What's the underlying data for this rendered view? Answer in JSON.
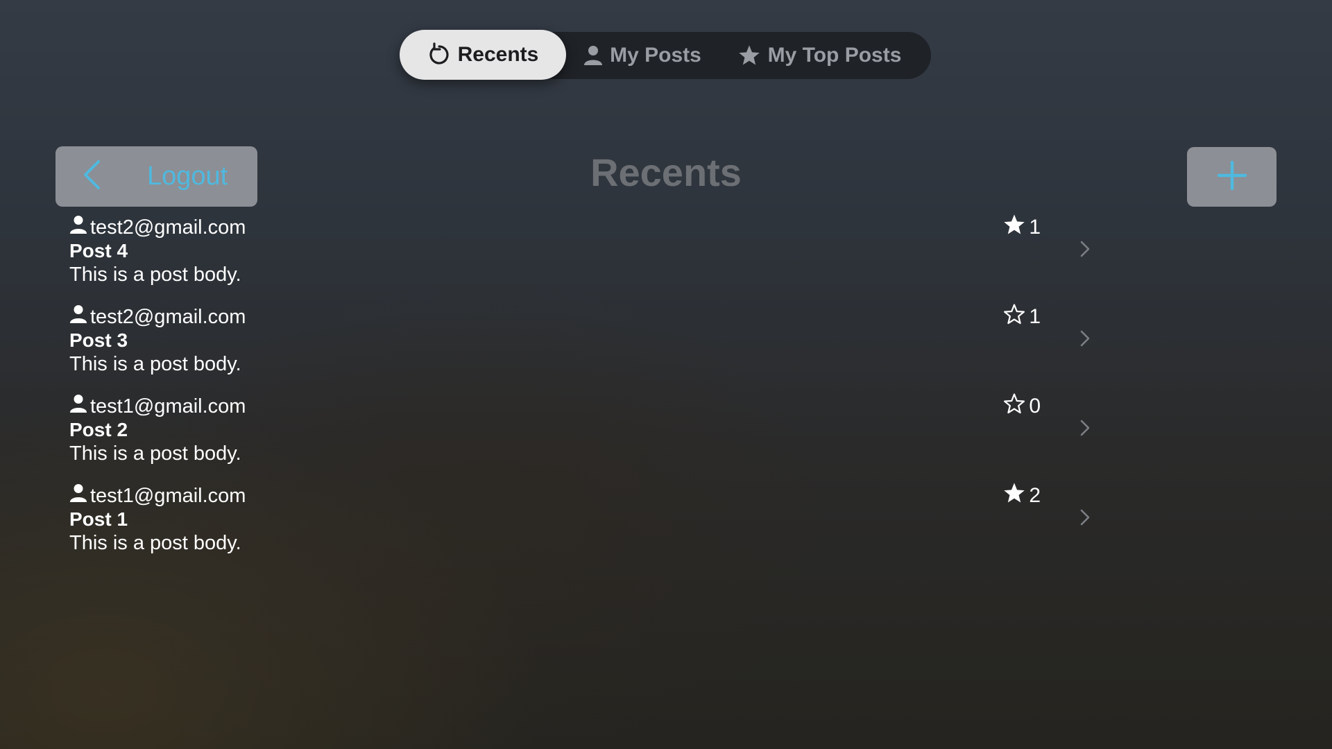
{
  "tabs": [
    {
      "label": "Recents",
      "icon": "refresh-icon",
      "active": true
    },
    {
      "label": "My Posts",
      "icon": "person-icon",
      "active": false
    },
    {
      "label": "My Top Posts",
      "icon": "star-icon",
      "active": false
    }
  ],
  "header": {
    "logout_label": "Logout",
    "title": "Recents",
    "add_icon": "plus-icon"
  },
  "colors": {
    "accent": "#4fb9df",
    "button_bg": "#8c8f95",
    "title_text": "#6c6f74"
  },
  "posts": [
    {
      "author": "test2@gmail.com",
      "title": "Post 4",
      "body": "This is a post body.",
      "stars": "1",
      "starred": true
    },
    {
      "author": "test2@gmail.com",
      "title": "Post 3",
      "body": "This is a post body.",
      "stars": "1",
      "starred": false
    },
    {
      "author": "test1@gmail.com",
      "title": "Post 2",
      "body": "This is a post body.",
      "stars": "0",
      "starred": false
    },
    {
      "author": "test1@gmail.com",
      "title": "Post 1",
      "body": "This is a post body.",
      "stars": "2",
      "starred": true
    }
  ]
}
